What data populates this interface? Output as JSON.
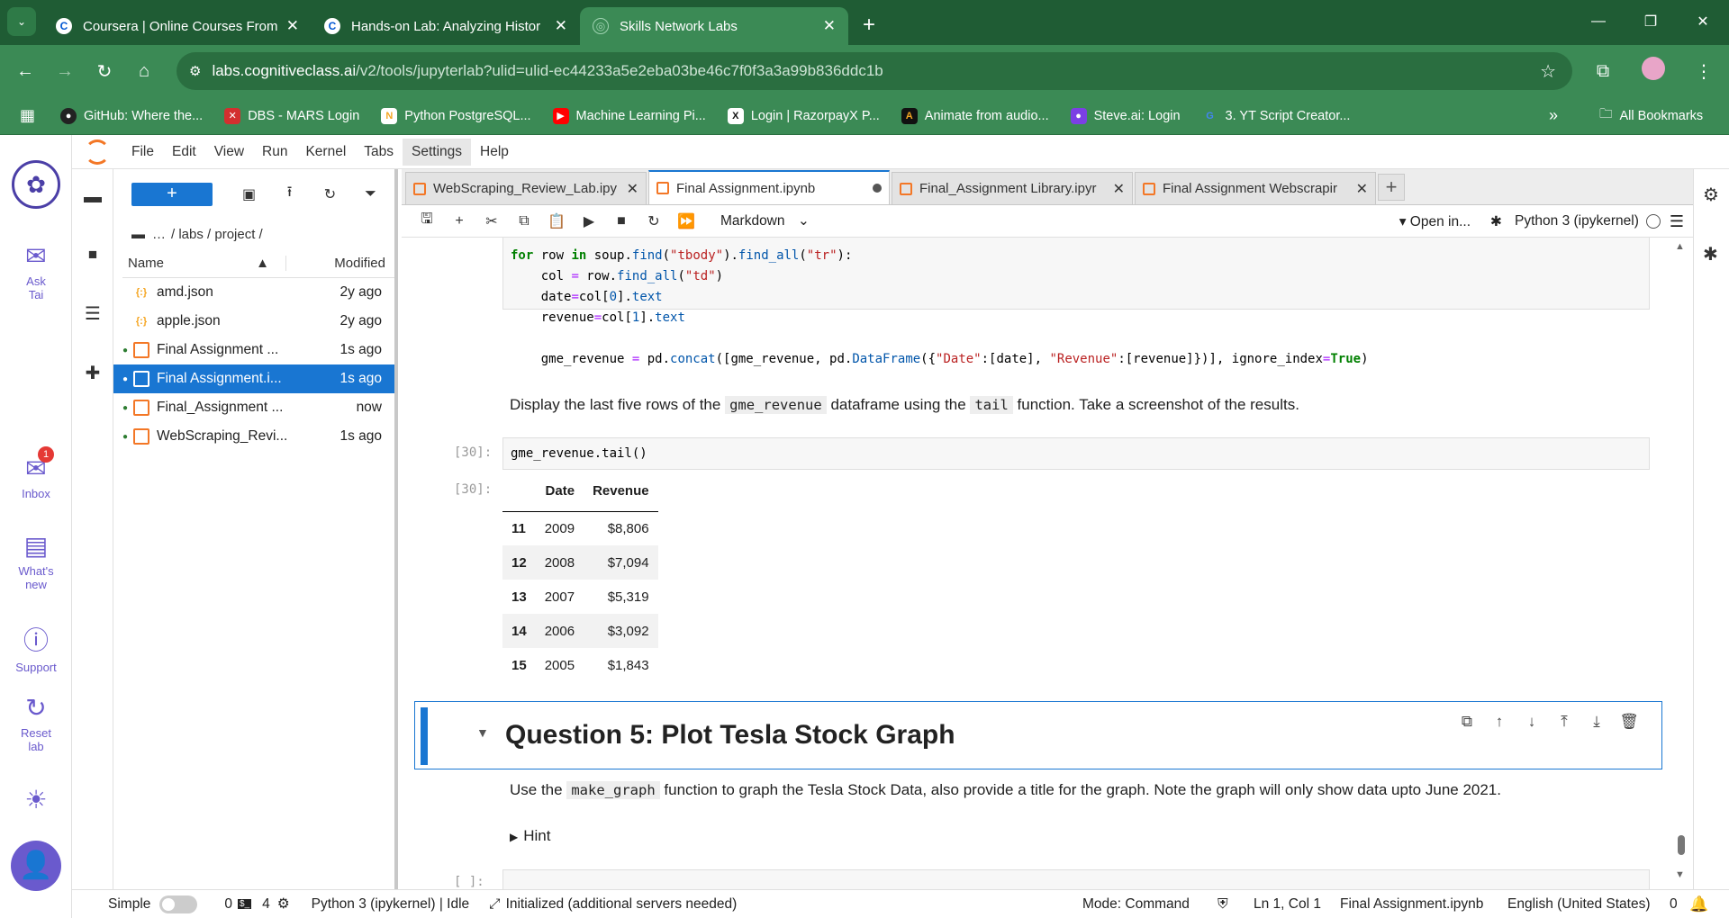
{
  "browser": {
    "tabs": [
      {
        "title": "Coursera | Online Courses From",
        "favicon": "C"
      },
      {
        "title": "Hands-on Lab: Analyzing Histor",
        "favicon": "C"
      },
      {
        "title": "Skills Network Labs",
        "favicon": "snl"
      }
    ],
    "url_host": "labs.cognitiveclass.ai",
    "url_path": "/v2/tools/jupyterlab?ulid=ulid-ec44233a5e2eba03be46c7f0f3a3a99b836ddc1b",
    "bookmarks": [
      {
        "label": "GitHub: Where the...",
        "color": "#222222"
      },
      {
        "label": "DBS - MARS Login",
        "color": "#d32f2f"
      },
      {
        "label": "Python PostgreSQL...",
        "color": "#f5a623"
      },
      {
        "label": "Machine Learning Pi...",
        "color": "#ff0000"
      },
      {
        "label": "Login | RazorpayX P...",
        "color": "#111111"
      },
      {
        "label": "Animate from audio...",
        "color": "#111111"
      },
      {
        "label": "Steve.ai: Login",
        "color": "#7b3fe4"
      },
      {
        "label": "3. YT Script Creator...",
        "color": "#4285f4"
      }
    ],
    "all_bookmarks": "All Bookmarks"
  },
  "rail": {
    "ask": "Ask Tai",
    "inbox": "Inbox",
    "inbox_badge": "1",
    "whats_new": "What's new",
    "support": "Support",
    "reset": "Reset lab"
  },
  "menu": [
    "File",
    "Edit",
    "View",
    "Run",
    "Kernel",
    "Tabs",
    "Settings",
    "Help"
  ],
  "filebrowser": {
    "breadcrumb": "/ labs / project /",
    "col_name": "Name",
    "col_modified": "Modified",
    "files": [
      {
        "name": "amd.json",
        "modified": "2y ago",
        "type": "json",
        "running": false,
        "selected": false
      },
      {
        "name": "apple.json",
        "modified": "2y ago",
        "type": "json",
        "running": false,
        "selected": false
      },
      {
        "name": "Final Assignment ...",
        "modified": "1s ago",
        "type": "nb",
        "running": true,
        "selected": false
      },
      {
        "name": "Final Assignment.i...",
        "modified": "1s ago",
        "type": "nb",
        "running": true,
        "selected": true
      },
      {
        "name": "Final_Assignment ...",
        "modified": "now",
        "type": "nb",
        "running": true,
        "selected": false
      },
      {
        "name": "WebScraping_Revi...",
        "modified": "1s ago",
        "type": "nb",
        "running": true,
        "selected": false
      }
    ]
  },
  "doc_tabs": [
    {
      "title": "WebScraping_Review_Lab.ipy",
      "active": false,
      "dirty": false
    },
    {
      "title": "Final Assignment.ipynb",
      "active": true,
      "dirty": true
    },
    {
      "title": "Final_Assignment Library.ipyr",
      "active": false,
      "dirty": false
    },
    {
      "title": "Final Assignment Webscrapir",
      "active": false,
      "dirty": false
    }
  ],
  "toolbar": {
    "cell_type": "Markdown",
    "open_in": "Open in...",
    "kernel": "Python 3 (ipykernel)"
  },
  "notebook": {
    "md1_pre": "Display the last five rows of the",
    "md1_code1": "gme_revenue",
    "md1_mid": "dataframe using the",
    "md1_code2": "tail",
    "md1_post": "function. Take a screenshot of the results.",
    "in_prompt": "[30]:",
    "out_prompt": "[30]:",
    "cell_code": "gme_revenue.tail()",
    "table": {
      "headers": [
        "",
        "Date",
        "Revenue"
      ],
      "rows": [
        [
          "11",
          "2009",
          "$8,806"
        ],
        [
          "12",
          "2008",
          "$7,094"
        ],
        [
          "13",
          "2007",
          "$5,319"
        ],
        [
          "14",
          "2006",
          "$3,092"
        ],
        [
          "15",
          "2005",
          "$1,843"
        ]
      ]
    },
    "heading": "Question 5: Plot Tesla Stock Graph",
    "md2_pre": "Use the",
    "md2_code": "make_graph",
    "md2_post": "function to graph the Tesla Stock Data, also provide a title for the graph. Note the graph will only show data upto June 2021.",
    "hint": "Hint",
    "next_prompt": "[ ]:"
  },
  "status": {
    "mode_label": "Simple",
    "terminals": "0",
    "kernels": "4",
    "kernel_status": "Python 3 (ipykernel) | Idle",
    "lsp": "Initialized (additional servers needed)",
    "mode": "Mode: Command",
    "cursor": "Ln 1, Col 1",
    "file": "Final Assignment.ipynb",
    "lang": "English (United States)",
    "notifications": "0"
  }
}
